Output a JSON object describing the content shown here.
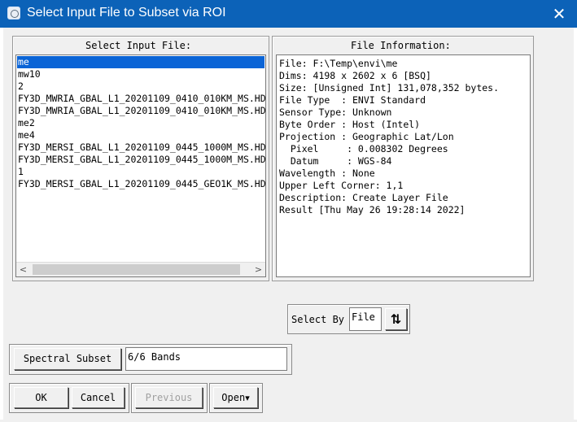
{
  "window": {
    "title": "Select Input File to Subset via ROI",
    "close_glyph": "✕",
    "icon": "envi-app-icon"
  },
  "input_panel": {
    "label": "Select Input File:",
    "selected_index": 0,
    "files": [
      "me",
      "mw10",
      "2",
      "FY3D_MWRIA_GBAL_L1_20201109_0410_010KM_MS.HDF",
      "FY3D_MWRIA_GBAL_L1_20201109_0410_010KM_MS.HDF",
      "me2",
      "me4",
      "FY3D_MERSI_GBAL_L1_20201109_0445_1000M_MS.HDF",
      "FY3D_MERSI_GBAL_L1_20201109_0445_1000M_MS.HDF",
      "1",
      "FY3D_MERSI_GBAL_L1_20201109_0445_GEO1K_MS.HDF"
    ],
    "scroll_left_glyph": "<",
    "scroll_right_glyph": ">"
  },
  "info_panel": {
    "label": "File Information:",
    "lines": [
      "File: F:\\Temp\\envi\\me",
      "Dims: 4198 x 2602 x 6 [BSQ]",
      "Size: [Unsigned Int] 131,078,352 bytes.",
      "File Type  : ENVI Standard",
      "Sensor Type: Unknown",
      "Byte Order : Host (Intel)",
      "Projection : Geographic Lat/Lon",
      "  Pixel     : 0.008302 Degrees",
      "  Datum     : WGS-84",
      "Wavelength : None",
      "Upper Left Corner: 1,1",
      "Description: Create Layer File",
      "Result [Thu May 26 19:28:14 2022]"
    ]
  },
  "select_by": {
    "label": "Select By",
    "value": "File",
    "toggle_glyph": "⇅"
  },
  "spectral": {
    "button_label": "Spectral Subset",
    "bands_value": "6/6 Bands"
  },
  "buttons": {
    "ok": "OK",
    "cancel": "Cancel",
    "previous": "Previous",
    "open": "Open",
    "open_arrow": "▾"
  }
}
